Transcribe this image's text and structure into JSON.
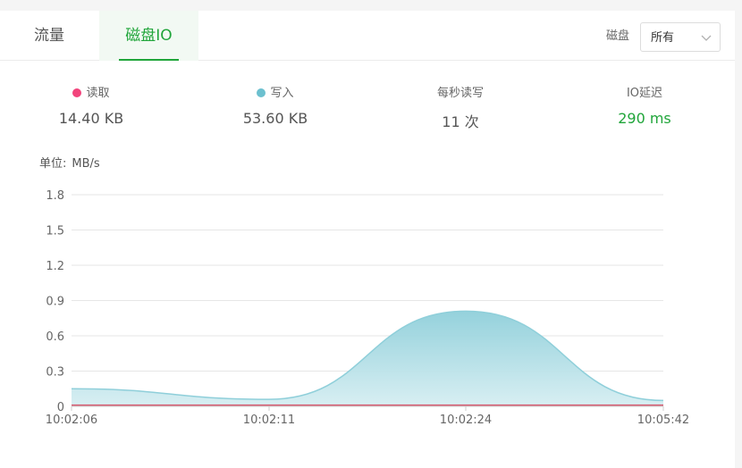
{
  "tabs": [
    "流量",
    "磁盘IO"
  ],
  "disk_filter": {
    "label": "磁盘",
    "value": "所有"
  },
  "stats": [
    {
      "label": "读取",
      "value": "14.40 KB",
      "dot_color": "#f2447c"
    },
    {
      "label": "写入",
      "value": "53.60 KB",
      "dot_color": "#6cc0cf"
    },
    {
      "label": "每秒读写",
      "value": "11 次"
    },
    {
      "label": "IO延迟",
      "value": "290 ms",
      "value_color": "#20a53a"
    }
  ],
  "colors": {
    "accent": "#20a53a",
    "read": "#d4566b",
    "write": "#8fcfda"
  },
  "chart_data": {
    "type": "area",
    "unit_label": "单位:",
    "unit": "MB/s",
    "x_labels": [
      "10:02:06",
      "10:02:11",
      "10:02:24",
      "10:05:42"
    ],
    "ylim": [
      0,
      1.8
    ],
    "y_ticks": [
      "0",
      "0.3",
      "0.6",
      "0.9",
      "1.2",
      "1.5",
      "1.8"
    ],
    "grid": true,
    "series": [
      {
        "name": "读取",
        "values": [
          0.01,
          0.01,
          0.01,
          0.01
        ]
      },
      {
        "name": "写入",
        "values": [
          0.15,
          0.06,
          0.81,
          0.05
        ]
      }
    ]
  }
}
